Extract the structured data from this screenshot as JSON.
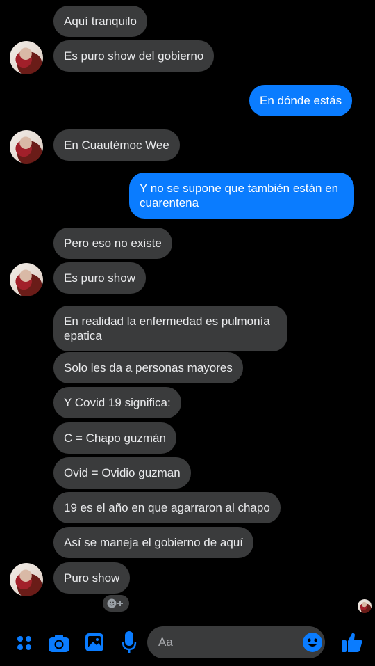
{
  "conversation": {
    "messages": [
      {
        "side": "in",
        "text": "Aquí tranquilo"
      },
      {
        "side": "in",
        "text": "Es puro show del gobierno"
      },
      {
        "side": "out",
        "text": "En dónde estás"
      },
      {
        "side": "in",
        "text": "En Cuautémoc Wee"
      },
      {
        "side": "out",
        "text": "Y no se supone que también están en cuarentena"
      },
      {
        "side": "in",
        "text": "Pero eso no existe"
      },
      {
        "side": "in",
        "text": "Es puro show"
      },
      {
        "side": "in",
        "text": "En realidad la enfermedad es pulmonía epatica"
      },
      {
        "side": "in",
        "text": "Solo les da a personas mayores"
      },
      {
        "side": "in",
        "text": "Y Covid 19 significa:"
      },
      {
        "side": "in",
        "text": "C = Chapo guzmán"
      },
      {
        "side": "in",
        "text": "Ovid = Ovidio guzman"
      },
      {
        "side": "in",
        "text": "19 es el año en que agarraron al chapo"
      },
      {
        "side": "in",
        "text": "Así se maneja el gobierno de aquí"
      },
      {
        "side": "in",
        "text": "Puro show"
      }
    ]
  },
  "composer": {
    "placeholder": "Aa",
    "icons": [
      "menu-grid-icon",
      "camera-icon",
      "gallery-icon",
      "microphone-icon",
      "emoji-icon",
      "thumbs-up-icon"
    ],
    "accent": "#0a7cff"
  },
  "colors": {
    "incoming_bubble": "#3a3b3c",
    "outgoing_bubble": "#0a7cff",
    "background": "#000000"
  }
}
